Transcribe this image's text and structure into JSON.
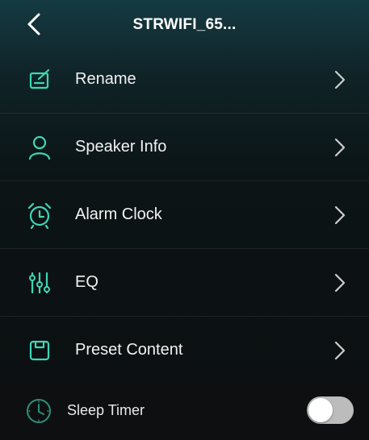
{
  "header": {
    "title": "STRWIFI_65...",
    "back_icon": "chevron-left-icon"
  },
  "accent_color": "#3fd6b5",
  "menu": [
    {
      "label": "Rename",
      "icon": "edit-icon"
    },
    {
      "label": "Speaker Info",
      "icon": "user-icon"
    },
    {
      "label": "Alarm Clock",
      "icon": "alarm-clock-icon"
    },
    {
      "label": "EQ",
      "icon": "equalizer-icon"
    },
    {
      "label": "Preset Content",
      "icon": "preset-icon"
    }
  ],
  "sleep_timer": {
    "label": "Sleep Timer",
    "icon": "clock-icon",
    "enabled": false
  }
}
